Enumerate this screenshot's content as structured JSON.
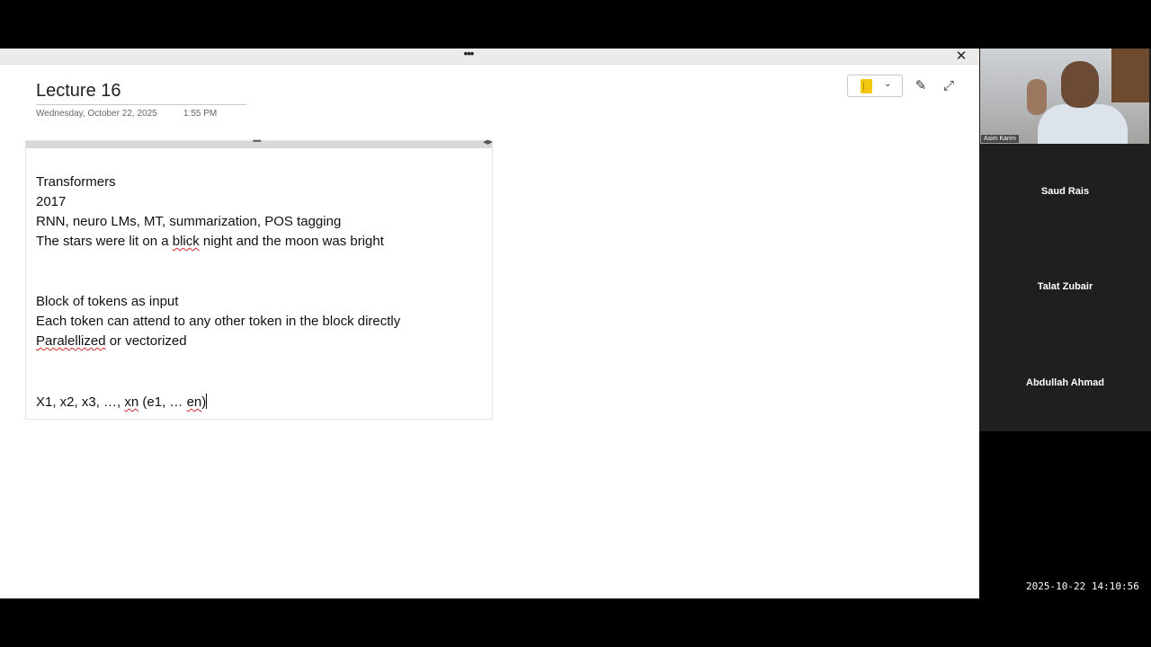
{
  "onenote": {
    "more_label": "•••",
    "close_label": "✕",
    "page_title": "Lecture 16",
    "page_date": "Wednesday, October 22, 2025",
    "page_time": "1:55 PM",
    "toolbar": {
      "notebook_icon": "notebook-icon",
      "chevron": "⌄",
      "pen_glyph": "✎",
      "expand_glyph": "⤢"
    },
    "container_handle": "••••",
    "container_resize": "◀▶",
    "notes": {
      "line1": "Transformers",
      "line2": "2017",
      "line3": "RNN, neuro LMs, MT, summarization, POS tagging",
      "line4_a": "The stars were lit on a ",
      "line4_b": "blick",
      "line4_c": " night and the moon was bright",
      "line5": "Block of tokens as input",
      "line6": "Each token can attend to any other token in the block directly",
      "line7_a": "Paralellized",
      "line7_b": " or vectorized",
      "line8_a": "X1, x2, x3, …, ",
      "line8_b": "xn",
      "line8_c": " (e1, … ",
      "line8_d": "en",
      "line8_e": ")"
    }
  },
  "meeting": {
    "video_name": "Asim Karim",
    "participants": [
      "Saud Rais",
      "Talat Zubair",
      "Abdullah Ahmad"
    ],
    "timestamp": "2025-10-22  14:10:56"
  }
}
